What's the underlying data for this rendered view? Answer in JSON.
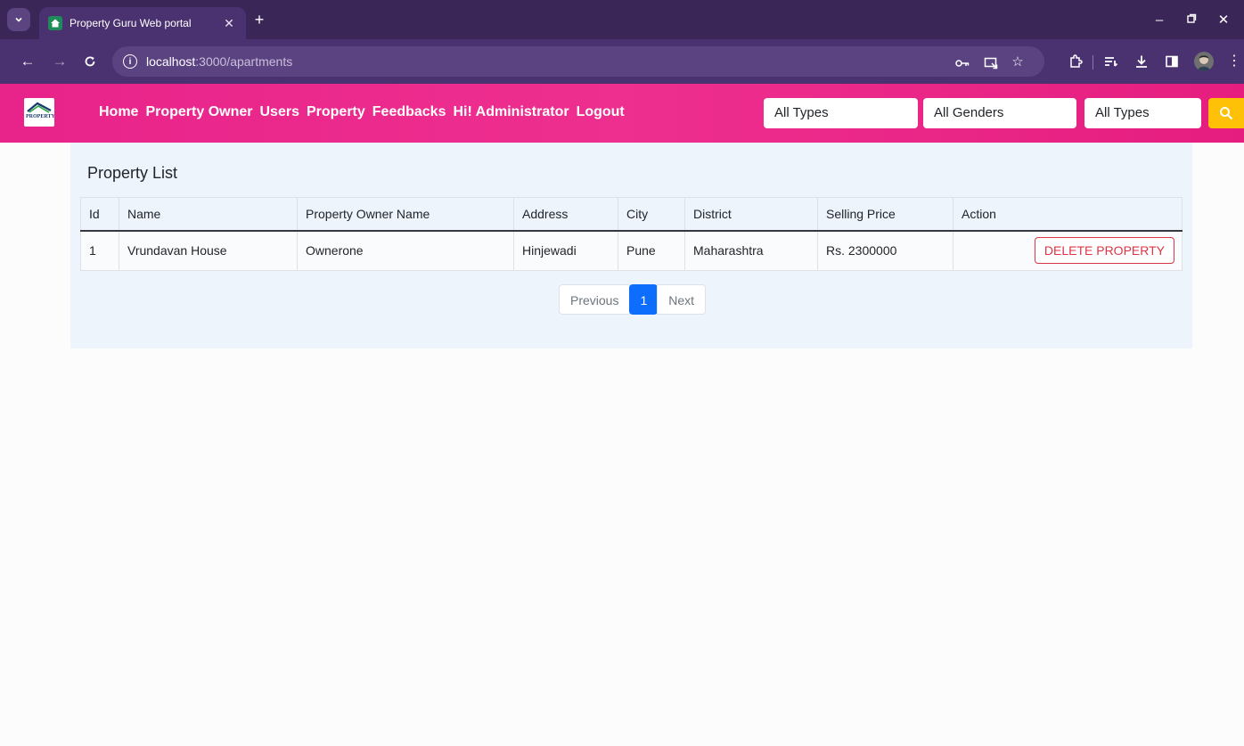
{
  "browser": {
    "tab_title": "Property Guru Web portal",
    "url_host": "localhost",
    "url_path": ":3000/apartments"
  },
  "navbar": {
    "logo_text": "PROPERTY",
    "links": [
      "Home",
      "Property Owner",
      "Users",
      "Property",
      "Feedbacks",
      "Hi! Administrator",
      "Logout"
    ],
    "filters": {
      "type_1": "All Types",
      "gender": "All Genders",
      "type_2": "All Types"
    }
  },
  "main": {
    "title": "Property List",
    "table": {
      "headers": [
        "Id",
        "Name",
        "Property Owner Name",
        "Address",
        "City",
        "District",
        "Selling Price",
        "Action"
      ],
      "rows": [
        [
          "1",
          "Vrundavan House",
          "Ownerone",
          "Hinjewadi",
          "Pune",
          "Maharashtra",
          "Rs. 2300000"
        ]
      ],
      "delete_label": "DELETE PROPERTY"
    },
    "pagination": {
      "prev": "Previous",
      "current": "1",
      "next": "Next"
    }
  },
  "colors": {
    "navbar": "#e8238a",
    "search_button": "#ffc107",
    "delete": "#dc3545",
    "page_active": "#0d6efd"
  }
}
